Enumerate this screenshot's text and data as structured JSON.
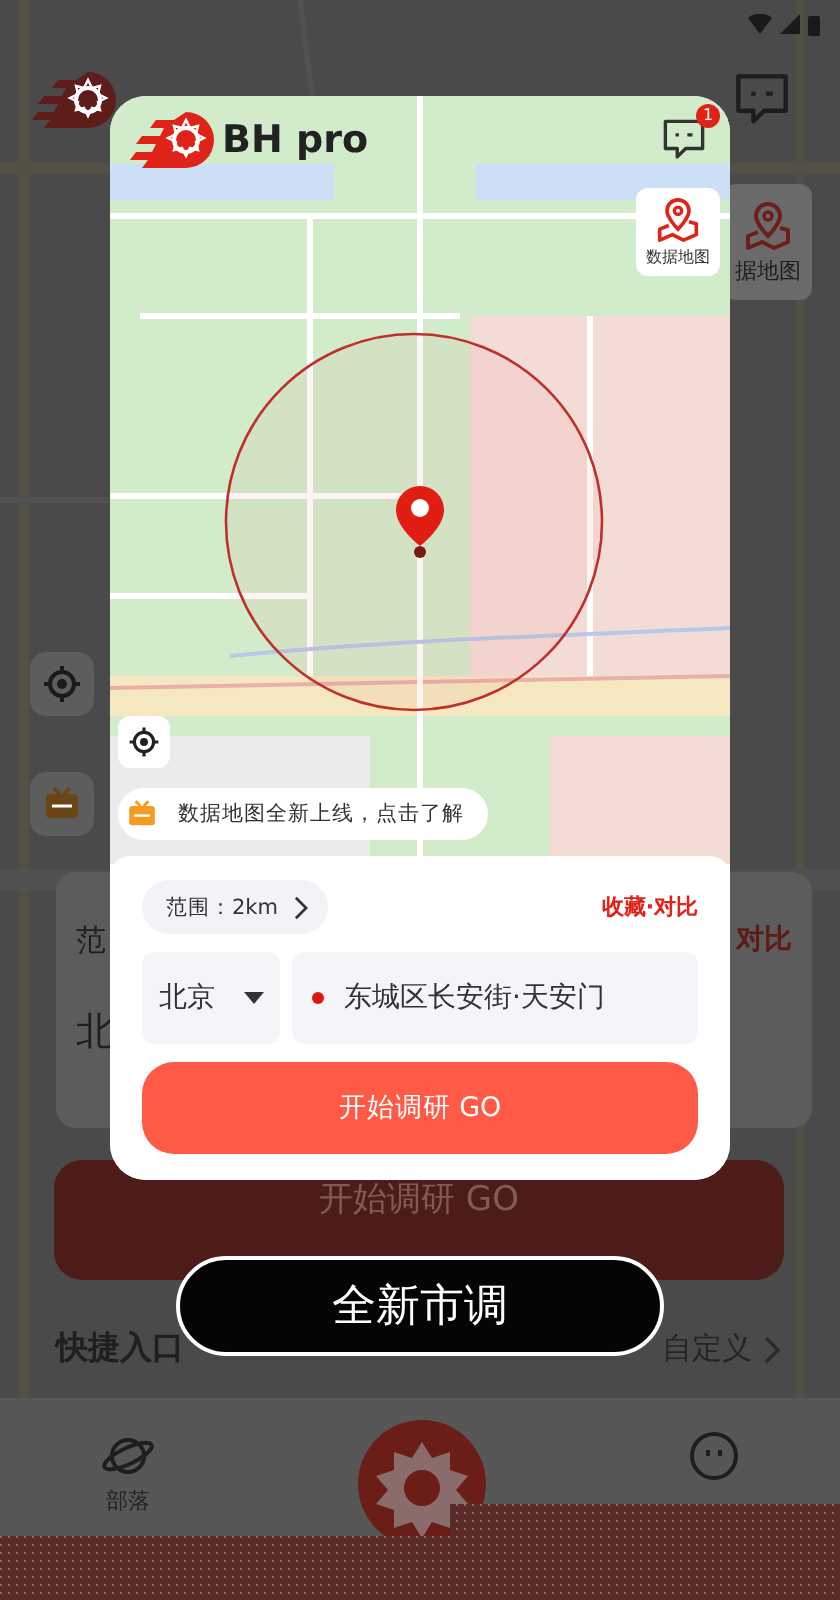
{
  "background": {
    "side_card_label": "据地图",
    "panel": {
      "range_fragment": "范",
      "compare_fragment": "对比",
      "city_fragment": "北",
      "start_button": "开始调研 GO"
    },
    "quick_entry": {
      "title": "快捷入口",
      "action": "自定义"
    },
    "tab_bar": [
      {
        "kind": "planet",
        "label": "部落"
      },
      {
        "kind": "logo"
      },
      {
        "kind": "smiley"
      }
    ]
  },
  "card": {
    "brand": "BH pro",
    "message_badge": "1",
    "data_map_button": "数据地图",
    "notice": "数据地图全新上线，点击了解",
    "range_chip": "范围：2km",
    "compare_link": "收藏·对比",
    "city": "北京",
    "address": "东城区长安街·天安门",
    "start_button": "开始调研 GO"
  },
  "toast": "全新市调"
}
